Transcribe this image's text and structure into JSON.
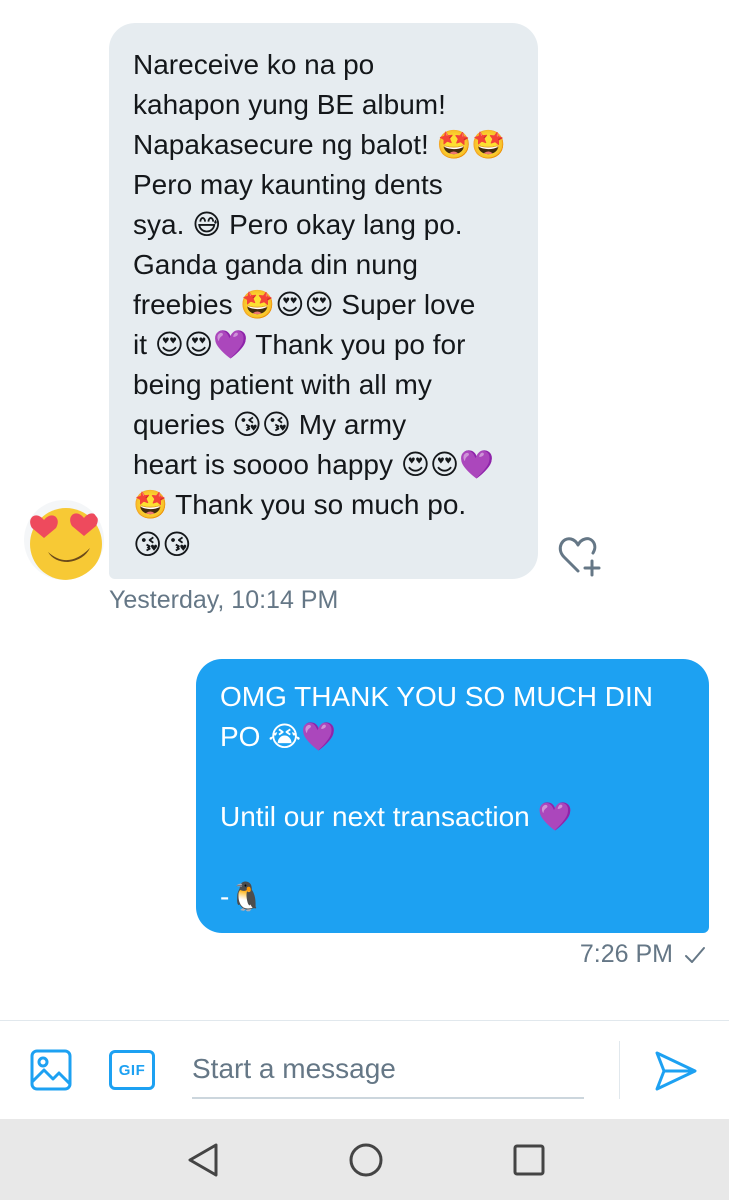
{
  "conversation": {
    "received": {
      "lines": [
        "Nareceive ko na po",
        "kahapon yung BE album!",
        "Napakasecure ng balot! 🤩🤩",
        "Pero may kaunting dents",
        "sya. 😅 Pero okay lang po.",
        "Ganda ganda din nung",
        "freebies 🤩😍😍 Super love",
        "it 😍😍💜 Thank you po for",
        "being patient with all my",
        "queries 😘😘 My army",
        "heart is soooo happy 😍😍💜",
        "🤩 Thank you so much po.",
        "😘😘"
      ],
      "timestamp": "Yesterday, 10:14 PM",
      "avatar_icon": "heart-eyes-emoji-avatar",
      "like_icon": "heart-plus-icon"
    },
    "sent": {
      "lines": [
        "OMG THANK YOU SO MUCH DIN",
        "PO 😭💜",
        "",
        "Until our next transaction 💜",
        "",
        "-🐧"
      ],
      "timestamp": "7:26 PM",
      "status_icon": "checkmark-icon"
    }
  },
  "composer": {
    "placeholder": "Start a message",
    "gif_label": "GIF",
    "media_icon": "image-icon",
    "send_icon": "send-icon"
  },
  "navigation": {
    "back_icon": "back-triangle-icon",
    "home_icon": "home-circle-icon",
    "recents_icon": "recents-square-icon"
  },
  "colors": {
    "accent": "#1da1f2",
    "received_bubble": "#e6ecf0",
    "muted_text": "#657786",
    "navbar": "#e8e8e8"
  }
}
